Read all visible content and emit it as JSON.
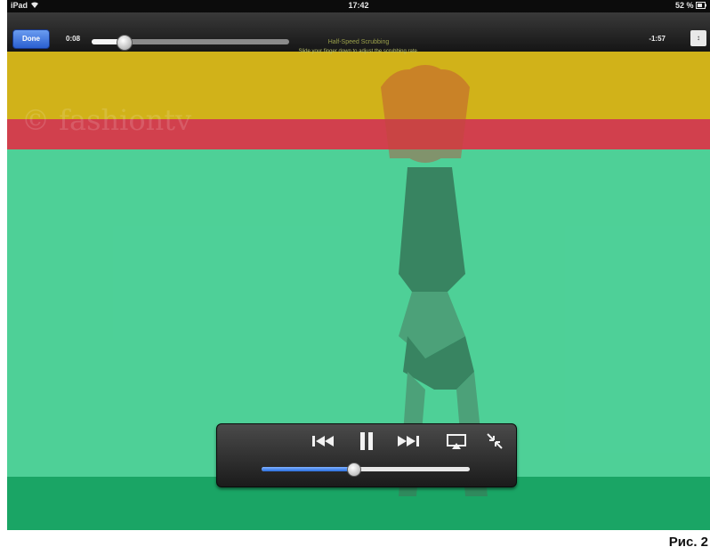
{
  "status_bar": {
    "device": "iPad",
    "time": "17:42",
    "battery": "52 %"
  },
  "player": {
    "done_label": "Done",
    "elapsed": "0:08",
    "remaining": "-1:57",
    "progress": 0.16,
    "speed_title": "Half-Speed Scrubbing",
    "speed_hint": "Slide your finger down to adjust the scrubbing rate.",
    "scale_label": "↕"
  },
  "video": {
    "watermark": "© fashiontv",
    "overlay_colors": {
      "yellow": "#e6c314",
      "red": "#e64150",
      "green": "#50dca0",
      "dark_green": "#1aa565"
    }
  },
  "controls": {
    "icons": [
      "previous-track-icon",
      "pause-icon",
      "next-track-icon",
      "airplay-icon",
      "exit-fullscreen-icon"
    ],
    "volume": 0.44
  },
  "caption": "Рис. 2"
}
